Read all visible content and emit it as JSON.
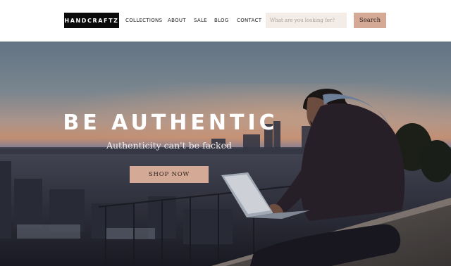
{
  "brand": {
    "logo_text": "HANDCRAFTZ"
  },
  "nav": {
    "items": [
      {
        "label": "COLLECTIONS"
      },
      {
        "label": "ABOUT"
      },
      {
        "label": "SALE"
      },
      {
        "label": "BLOG"
      },
      {
        "label": "CONTACT"
      }
    ]
  },
  "search": {
    "placeholder": "What are you looking for?",
    "value": "",
    "button_label": "Search"
  },
  "hero": {
    "title": "BE AUTHENTIC",
    "subtitle": "Authenticity can't be facked",
    "cta_label": "SHOP NOW",
    "image_icon": "man-with-laptop-city-sunset-photo"
  },
  "colors": {
    "accent": "#d4aa96",
    "search_bg": "#f4ece6",
    "logo_bg": "#0b0b0b",
    "header_bg": "#ffffff"
  }
}
